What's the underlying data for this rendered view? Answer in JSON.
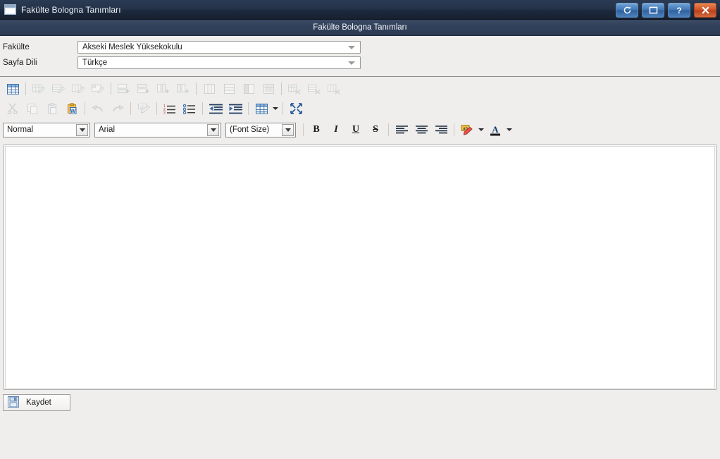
{
  "window": {
    "title": "Fakülte Bologna Tanımları",
    "icon": "window-form-icon",
    "buttons": [
      {
        "name": "refresh-button",
        "icon": "refresh-icon",
        "label": ""
      },
      {
        "name": "restore-button",
        "icon": "restore-icon",
        "label": ""
      },
      {
        "name": "help-button",
        "icon": "help-icon",
        "label": "?"
      },
      {
        "name": "close-button",
        "icon": "close-icon",
        "label": "×"
      }
    ]
  },
  "header": {
    "title": "Fakülte Bologna Tanımları"
  },
  "form": {
    "faculty": {
      "label": "Fakülte",
      "value": "Akseki Meslek Yüksekokulu"
    },
    "page_language": {
      "label": "Sayfa Dili",
      "value": "Türkçe"
    }
  },
  "toolbar_row1": [
    {
      "name": "insert-table-button",
      "icon": "table-grid-icon",
      "enabled": true
    },
    {
      "sep": true
    },
    {
      "name": "table-properties-button",
      "icon": "table-edit-icon",
      "enabled": false
    },
    {
      "name": "row-properties-button",
      "icon": "table-row-edit-icon",
      "enabled": false
    },
    {
      "name": "column-properties-button",
      "icon": "table-col-edit-icon",
      "enabled": false
    },
    {
      "name": "cell-properties-button",
      "icon": "table-cell-edit-icon",
      "enabled": false
    },
    {
      "sep": true
    },
    {
      "name": "insert-row-above-button",
      "icon": "row-insert-above-icon",
      "enabled": false
    },
    {
      "name": "insert-row-below-button",
      "icon": "row-insert-below-icon",
      "enabled": false
    },
    {
      "name": "insert-column-left-button",
      "icon": "column-insert-left-icon",
      "enabled": false
    },
    {
      "name": "insert-column-right-button",
      "icon": "column-insert-right-icon",
      "enabled": false
    },
    {
      "sep": true
    },
    {
      "name": "split-cell-vertical-button",
      "icon": "cell-split-vertical-icon",
      "enabled": false
    },
    {
      "name": "split-cell-horizontal-button",
      "icon": "cell-split-horizontal-icon",
      "enabled": false
    },
    {
      "name": "merge-cells-left-button",
      "icon": "cell-merge-left-icon",
      "enabled": false
    },
    {
      "name": "merge-cells-button",
      "icon": "cell-merge-icon",
      "enabled": false
    },
    {
      "sep": true
    },
    {
      "name": "delete-table-button",
      "icon": "table-delete-icon",
      "enabled": false
    },
    {
      "name": "delete-row-button",
      "icon": "row-delete-icon",
      "enabled": false
    },
    {
      "name": "delete-column-button",
      "icon": "column-delete-icon",
      "enabled": false
    }
  ],
  "toolbar_row2": [
    {
      "name": "cut-button",
      "icon": "scissors-icon",
      "enabled": false
    },
    {
      "name": "copy-button",
      "icon": "copy-icon",
      "enabled": false
    },
    {
      "name": "paste-button",
      "icon": "paste-icon",
      "enabled": false
    },
    {
      "name": "paste-from-word-button",
      "icon": "paste-word-icon",
      "enabled": true
    },
    {
      "sep": true
    },
    {
      "name": "undo-button",
      "icon": "undo-arrow-icon",
      "enabled": false
    },
    {
      "name": "redo-button",
      "icon": "redo-arrow-icon",
      "enabled": false
    },
    {
      "sep": true
    },
    {
      "name": "find-replace-button",
      "icon": "find-replace-icon",
      "enabled": false
    },
    {
      "sep": true
    },
    {
      "name": "numbered-list-button",
      "icon": "numbered-list-icon",
      "enabled": true
    },
    {
      "name": "bulleted-list-button",
      "icon": "bulleted-list-icon",
      "enabled": true
    },
    {
      "sep": true
    },
    {
      "name": "decrease-indent-button",
      "icon": "outdent-icon",
      "enabled": true
    },
    {
      "name": "increase-indent-button",
      "icon": "indent-icon",
      "enabled": true
    },
    {
      "sep": true
    },
    {
      "name": "table-button",
      "icon": "table-grid-icon",
      "enabled": true,
      "caret": true
    },
    {
      "sep": true
    },
    {
      "name": "fullscreen-button",
      "icon": "fullscreen-icon",
      "enabled": true
    }
  ],
  "format_bar": {
    "paragraph_format": {
      "label": "Normal"
    },
    "font_family": {
      "label": "Arial"
    },
    "font_size": {
      "label": "(Font Size)"
    },
    "buttons": [
      {
        "name": "bold-button",
        "glyph": "B",
        "style": "bold"
      },
      {
        "name": "italic-button",
        "glyph": "I",
        "style": "italic"
      },
      {
        "name": "underline-button",
        "glyph": "U",
        "style": "underline"
      },
      {
        "name": "strikethrough-button",
        "glyph": "S",
        "style": "strike"
      }
    ],
    "align_buttons": [
      {
        "name": "align-left-button",
        "icon": "align-left-icon"
      },
      {
        "name": "align-center-button",
        "icon": "align-center-icon"
      },
      {
        "name": "align-right-button",
        "icon": "align-right-icon"
      }
    ],
    "highlight": {
      "name": "highlight-color-button",
      "icon": "highlighter-icon",
      "color": "#e8b84b"
    },
    "fontcolor": {
      "name": "font-color-button",
      "icon": "font-color-icon",
      "color": "#1f1f1f"
    }
  },
  "editor": {
    "name": "rich-text-editor",
    "content": ""
  },
  "footer": {
    "save": {
      "label": "Kaydet",
      "icon": "floppy-save-icon"
    }
  },
  "colors": {
    "titlebar_dark": "#1d2a3e",
    "header_bar": "#31405a",
    "page_bg": "#efeeec",
    "accent_blue": "#3f76b4",
    "close_red": "#d1522a"
  }
}
